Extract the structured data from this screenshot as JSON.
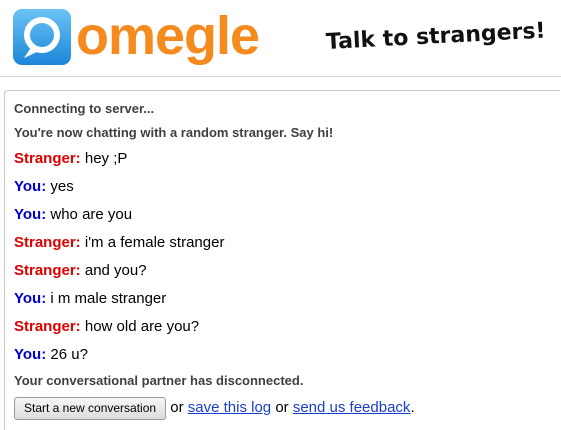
{
  "header": {
    "logo_text": "omegle",
    "tagline": "Talk to strangers!"
  },
  "colors": {
    "brand_orange": "#f58a1f",
    "brand_blue": "#3ca4e8",
    "stranger": "#dd0000",
    "you": "#0000cc",
    "link": "#1a3fc8"
  },
  "log": {
    "status_connecting": "Connecting to server...",
    "status_connected": "You're now chatting with a random stranger. Say hi!",
    "messages": [
      {
        "who": "Stranger:",
        "text": " hey ;P"
      },
      {
        "who": "You:",
        "text": " yes"
      },
      {
        "who": "You:",
        "text": " who are you"
      },
      {
        "who": "Stranger:",
        "text": " i'm a female stranger"
      },
      {
        "who": "Stranger:",
        "text": " and you?"
      },
      {
        "who": "You:",
        "text": " i m male stranger"
      },
      {
        "who": "Stranger:",
        "text": " how old are you?"
      },
      {
        "who": "You:",
        "text": " 26 u?"
      }
    ],
    "status_disconnected": "Your conversational partner has disconnected."
  },
  "actions": {
    "new_conversation_label": "Start a new conversation",
    "or_1": " or ",
    "save_log_label": "save this log",
    "or_2": " or ",
    "feedback_label": "send us feedback",
    "period": "."
  }
}
